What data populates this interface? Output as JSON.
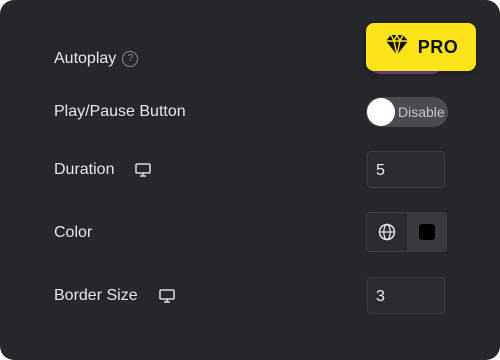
{
  "autoplay": {
    "label": "Autoplay",
    "help_icon": "help-circle-icon",
    "help_glyph": "?"
  },
  "pro_badge": {
    "label": "PRO",
    "icon": "diamond-icon",
    "color": "#fbe419"
  },
  "play_pause": {
    "label": "Play/Pause Button",
    "toggle_text": "Disable"
  },
  "duration": {
    "label": "Duration",
    "device_icon": "desktop-icon",
    "value": "5"
  },
  "color": {
    "label": "Color",
    "global_icon": "globe-icon",
    "swatch_color": "#000000"
  },
  "border_size": {
    "label": "Border Size",
    "device_icon": "desktop-icon",
    "value": "3"
  },
  "theme": {
    "background": "#26272b",
    "text": "#e6e7ea",
    "accent": "#fbe419"
  }
}
